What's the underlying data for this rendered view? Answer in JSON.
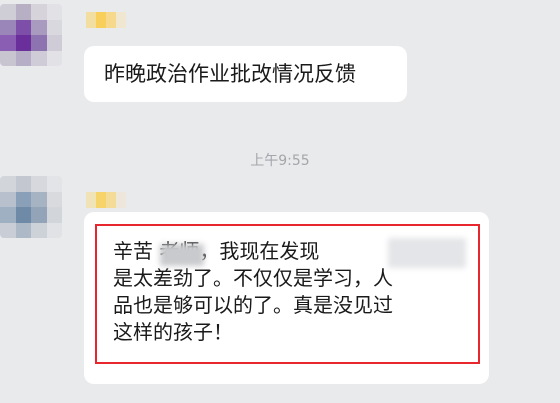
{
  "chat": {
    "messages": [
      {
        "text": "昨晚政治作业批改情况反馈"
      },
      {
        "lines": [
          "辛苦    老师，我现在发现",
          "是太差劲了。不仅仅是学习，人",
          "品也是够可以的了。真是没见过",
          "这样的孩子！"
        ]
      }
    ],
    "timestamp": "上午9:55"
  },
  "colors": {
    "background": "#e9eaec",
    "bubble": "#ffffff",
    "highlight_border": "#e8262d",
    "timestamp_text": "#a3a6aa"
  }
}
